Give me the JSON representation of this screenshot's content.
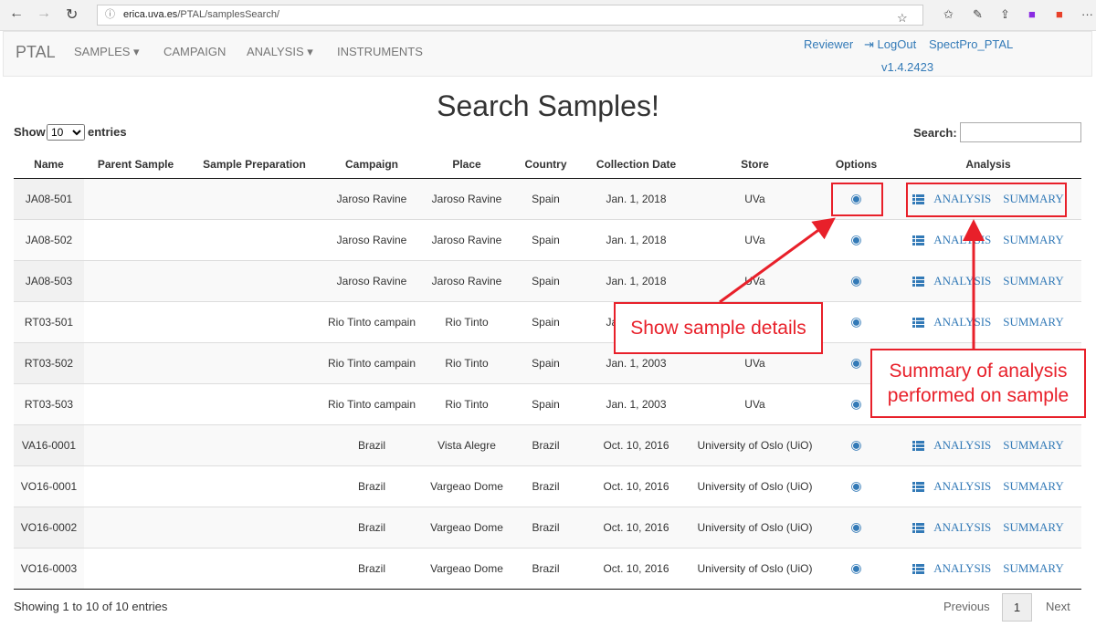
{
  "browser": {
    "url_host": "erica.uva.es",
    "url_path": "/PTAL/samplesSearch/"
  },
  "navbar": {
    "brand": "PTAL",
    "items": [
      "SAMPLES ▾",
      "CAMPAIGN",
      "ANALYSIS ▾",
      "INSTRUMENTS"
    ],
    "user": "Reviewer",
    "logout": "LogOut",
    "app": "SpectPro_PTAL",
    "version": "v1.4.2423"
  },
  "title": "Search Samples!",
  "controls": {
    "show": "Show",
    "entries": "entries",
    "page_size": "10",
    "search_label": "Search:",
    "search_value": ""
  },
  "table": {
    "headers": [
      "Name",
      "Parent Sample",
      "Sample Preparation",
      "Campaign",
      "Place",
      "Country",
      "Collection Date",
      "Store",
      "Options",
      "Analysis"
    ],
    "rows": [
      [
        "JA08-501",
        "",
        "",
        "Jaroso Ravine",
        "Jaroso Ravine",
        "Spain",
        "Jan. 1, 2018",
        "UVa"
      ],
      [
        "JA08-502",
        "",
        "",
        "Jaroso Ravine",
        "Jaroso Ravine",
        "Spain",
        "Jan. 1, 2018",
        "UVa"
      ],
      [
        "JA08-503",
        "",
        "",
        "Jaroso Ravine",
        "Jaroso Ravine",
        "Spain",
        "Jan. 1, 2018",
        "UVa"
      ],
      [
        "RT03-501",
        "",
        "",
        "Rio Tinto campain",
        "Rio Tinto",
        "Spain",
        "Jan. 1, 2003",
        "UVa"
      ],
      [
        "RT03-502",
        "",
        "",
        "Rio Tinto campain",
        "Rio Tinto",
        "Spain",
        "Jan. 1, 2003",
        "UVa"
      ],
      [
        "RT03-503",
        "",
        "",
        "Rio Tinto campain",
        "Rio Tinto",
        "Spain",
        "Jan. 1, 2003",
        "UVa"
      ],
      [
        "VA16-0001",
        "",
        "",
        "Brazil",
        "Vista Alegre",
        "Brazil",
        "Oct. 10, 2016",
        "University of Oslo (UiO)"
      ],
      [
        "VO16-0001",
        "",
        "",
        "Brazil",
        "Vargeao Dome",
        "Brazil",
        "Oct. 10, 2016",
        "University of Oslo (UiO)"
      ],
      [
        "VO16-0002",
        "",
        "",
        "Brazil",
        "Vargeao Dome",
        "Brazil",
        "Oct. 10, 2016",
        "University of Oslo (UiO)"
      ],
      [
        "VO16-0003",
        "",
        "",
        "Brazil",
        "Vargeao Dome",
        "Brazil",
        "Oct. 10, 2016",
        "University of Oslo (UiO)"
      ]
    ],
    "analysis_label": "ANALYSIS",
    "summary_label": "SUMMARY"
  },
  "footer": {
    "info": "Showing 1 to 10 of 10 entries",
    "previous": "Previous",
    "page": "1",
    "next": "Next"
  },
  "annotations": {
    "details": "Show sample details",
    "summary": "Summary of analysis performed on sample"
  },
  "colors": {
    "link": "#337ab7",
    "annotation": "#e8202a"
  }
}
